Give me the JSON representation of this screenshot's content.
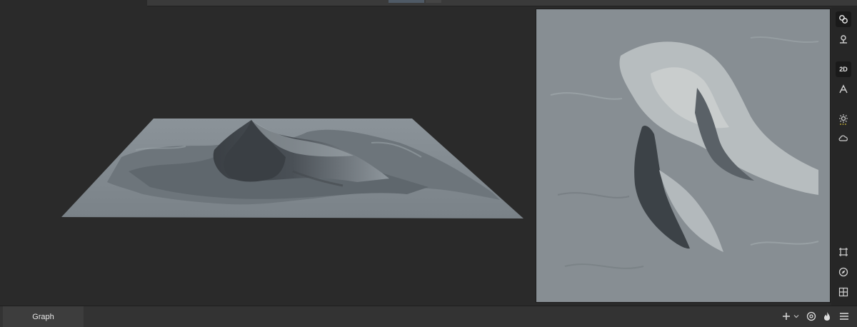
{
  "toolbar_right": {
    "items": [
      {
        "name": "link-icon"
      },
      {
        "name": "pin-icon"
      },
      {
        "name": "2d-view-toggle",
        "label": "2D"
      },
      {
        "name": "measure-icon"
      },
      {
        "name": "sun-light-icon"
      },
      {
        "name": "cloud-icon"
      },
      {
        "name": "frame-icon"
      },
      {
        "name": "compass-icon"
      },
      {
        "name": "grid-icon"
      }
    ]
  },
  "bottom_bar": {
    "tab_label": "Graph",
    "icons": [
      "plus-icon",
      "chevron-down-icon",
      "at-icon",
      "flame-icon",
      "menu-icon"
    ]
  }
}
